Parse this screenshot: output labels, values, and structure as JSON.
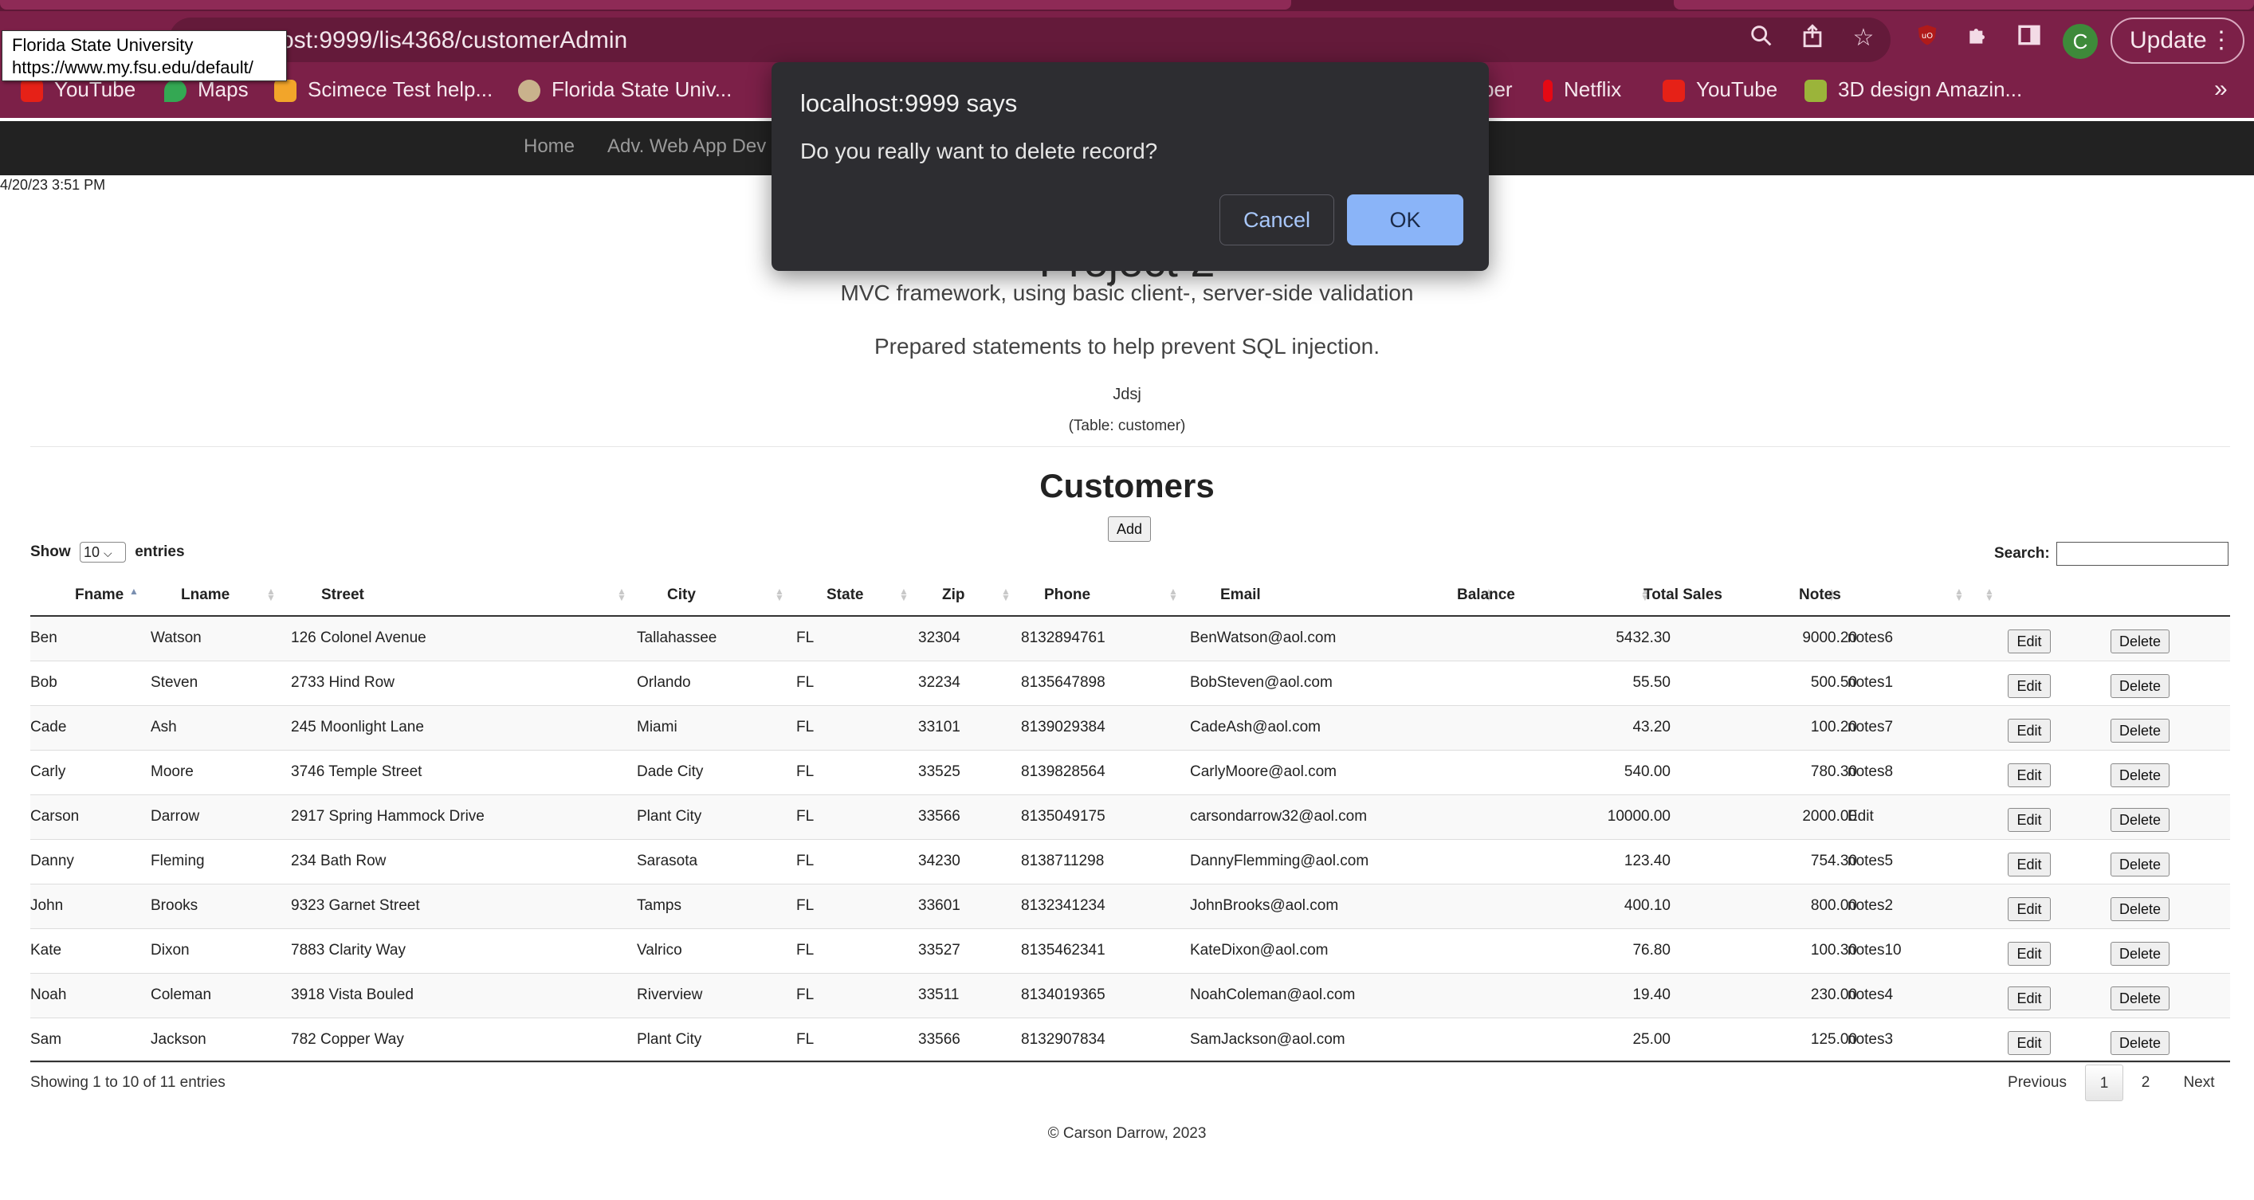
{
  "browser": {
    "address": "ost:9999/lis4368/customerAdmin",
    "profile_initial": "C",
    "update_label": "Update",
    "tooltip_title": "Florida State University",
    "tooltip_url": "https://www.my.fsu.edu/default/",
    "bookmarks": [
      "YouTube",
      "Maps",
      "Scimece Test help...",
      "Florida State Univ...",
      "ber",
      "Netflix",
      "YouTube",
      "3D design Amazin..."
    ],
    "overflow_label": "»"
  },
  "nav": {
    "home": "Home",
    "adv": "Adv. Web App Dev"
  },
  "timestamp": "4/20/23 3:51 PM",
  "page": {
    "title": "Project 2",
    "subtitle1": "MVC framework, using basic client-, server-side validation",
    "subtitle2": "Prepared statements to help prevent SQL injection.",
    "author": "Jdsj",
    "table_caption": "(Table: customer)",
    "heading": "Customers",
    "add_label": "Add",
    "show_label": "Show",
    "entries_label": "entries",
    "length_value": "10",
    "search_label": "Search:",
    "info": "Showing 1 to 10 of 11 entries",
    "footer": "© Carson Darrow, 2023"
  },
  "pagination": {
    "previous": "Previous",
    "current": "1",
    "next_page": "2",
    "next": "Next"
  },
  "table": {
    "columns": [
      "Fname",
      "Lname",
      "Street",
      "City",
      "State",
      "Zip",
      "Phone",
      "Email",
      "Balance",
      "Total Sales",
      "Notes"
    ],
    "edit_label": "Edit",
    "delete_label": "Delete",
    "rows": [
      [
        "Ben",
        "Watson",
        "126 Colonel Avenue",
        "Tallahassee",
        "FL",
        "32304",
        "8132894761",
        "BenWatson@aol.com",
        "5432.30",
        "9000.20",
        "notes6"
      ],
      [
        "Bob",
        "Steven",
        "2733 Hind Row",
        "Orlando",
        "FL",
        "32234",
        "8135647898",
        "BobSteven@aol.com",
        "55.50",
        "500.50",
        "notes1"
      ],
      [
        "Cade",
        "Ash",
        "245 Moonlight Lane",
        "Miami",
        "FL",
        "33101",
        "8139029384",
        "CadeAsh@aol.com",
        "43.20",
        "100.20",
        "notes7"
      ],
      [
        "Carly",
        "Moore",
        "3746 Temple Street",
        "Dade City",
        "FL",
        "33525",
        "8139828564",
        "CarlyMoore@aol.com",
        "540.00",
        "780.30",
        "notes8"
      ],
      [
        "Carson",
        "Darrow",
        "2917 Spring Hammock Drive",
        "Plant City",
        "FL",
        "33566",
        "8135049175",
        "carsondarrow32@aol.com",
        "10000.00",
        "2000.00",
        "Edit"
      ],
      [
        "Danny",
        "Fleming",
        "234 Bath Row",
        "Sarasota",
        "FL",
        "34230",
        "8138711298",
        "DannyFlemming@aol.com",
        "123.40",
        "754.30",
        "notes5"
      ],
      [
        "John",
        "Brooks",
        "9323 Garnet Street",
        "Tamps",
        "FL",
        "33601",
        "8132341234",
        "JohnBrooks@aol.com",
        "400.10",
        "800.00",
        "notes2"
      ],
      [
        "Kate",
        "Dixon",
        "7883 Clarity Way",
        "Valrico",
        "FL",
        "33527",
        "8135462341",
        "KateDixon@aol.com",
        "76.80",
        "100.30",
        "notes10"
      ],
      [
        "Noah",
        "Coleman",
        "3918 Vista Bouled",
        "Riverview",
        "FL",
        "33511",
        "8134019365",
        "NoahColeman@aol.com",
        "19.40",
        "230.00",
        "notes4"
      ],
      [
        "Sam",
        "Jackson",
        "782 Copper Way",
        "Plant City",
        "FL",
        "33566",
        "8132907834",
        "SamJackson@aol.com",
        "25.00",
        "125.00",
        "notes3"
      ]
    ]
  },
  "dialog": {
    "title": "localhost:9999 says",
    "message": "Do you really want to delete record?",
    "cancel": "Cancel",
    "ok": "OK"
  },
  "colors": {
    "chrome": "#7c2048",
    "nav": "#222222",
    "dialog_bg": "#2d2d31",
    "ok_button": "#8ab4f8"
  },
  "icons": [
    "zoom-icon",
    "share-icon",
    "star-icon",
    "ublock-icon",
    "extensions-icon",
    "sidepanel-icon",
    "more-icon"
  ]
}
